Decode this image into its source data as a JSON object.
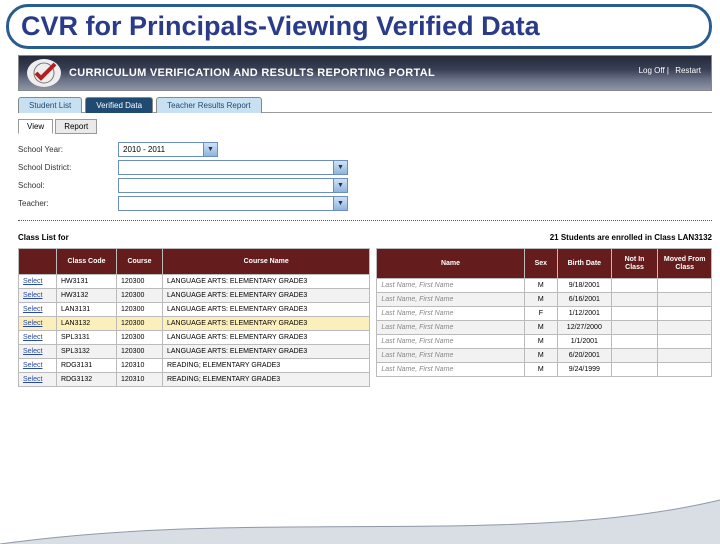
{
  "slide": {
    "title": "CVR for Principals-Viewing Verified Data"
  },
  "banner": {
    "title": "CURRICULUM VERIFICATION AND RESULTS REPORTING PORTAL",
    "logoff": "Log Off",
    "restart": "Restart"
  },
  "tabs": [
    "Student List",
    "Verified Data",
    "Teacher Results Report"
  ],
  "active_tab": 1,
  "subtabs": [
    "View",
    "Report"
  ],
  "active_subtab": 0,
  "filters": {
    "school_year": {
      "label": "School Year:",
      "value": "2010 - 2011"
    },
    "district": {
      "label": "School District:",
      "value": ""
    },
    "school": {
      "label": "School:",
      "value": ""
    },
    "teacher": {
      "label": "Teacher:",
      "value": ""
    }
  },
  "class_list": {
    "header": "Class List for",
    "columns": {
      "select": "",
      "class_code": "Class Code",
      "course": "Course",
      "course_name": "Course Name"
    },
    "select_label": "Select",
    "rows": [
      {
        "code": "HW3131",
        "course": "120300",
        "name": "LANGUAGE ARTS: ELEMENTARY GRADE3",
        "hl": false
      },
      {
        "code": "HW3132",
        "course": "120300",
        "name": "LANGUAGE ARTS: ELEMENTARY GRADE3",
        "hl": false
      },
      {
        "code": "LAN3131",
        "course": "120300",
        "name": "LANGUAGE ARTS: ELEMENTARY GRADE3",
        "hl": false
      },
      {
        "code": "LAN3132",
        "course": "120300",
        "name": "LANGUAGE ARTS: ELEMENTARY GRADE3",
        "hl": true
      },
      {
        "code": "SPL3131",
        "course": "120300",
        "name": "LANGUAGE ARTS: ELEMENTARY GRADE3",
        "hl": false
      },
      {
        "code": "SPL3132",
        "course": "120300",
        "name": "LANGUAGE ARTS: ELEMENTARY GRADE3",
        "hl": false
      },
      {
        "code": "RDG3131",
        "course": "120310",
        "name": "READING; ELEMENTARY GRADE3",
        "hl": false
      },
      {
        "code": "RDG3132",
        "course": "120310",
        "name": "READING; ELEMENTARY GRADE3",
        "hl": false
      }
    ]
  },
  "students": {
    "header": "21 Students are enrolled in Class LAN3132",
    "columns": {
      "name": "Name",
      "sex": "Sex",
      "birth": "Birth Date",
      "notin": "Not In Class",
      "moved": "Moved From Class"
    },
    "placeholder": "Last Name, First Name",
    "rows": [
      {
        "sex": "M",
        "dob": "9/18/2001"
      },
      {
        "sex": "M",
        "dob": "6/16/2001"
      },
      {
        "sex": "F",
        "dob": "1/12/2001"
      },
      {
        "sex": "M",
        "dob": "12/27/2000"
      },
      {
        "sex": "M",
        "dob": "1/1/2001"
      },
      {
        "sex": "M",
        "dob": "6/20/2001"
      },
      {
        "sex": "M",
        "dob": "9/24/1999"
      }
    ]
  }
}
